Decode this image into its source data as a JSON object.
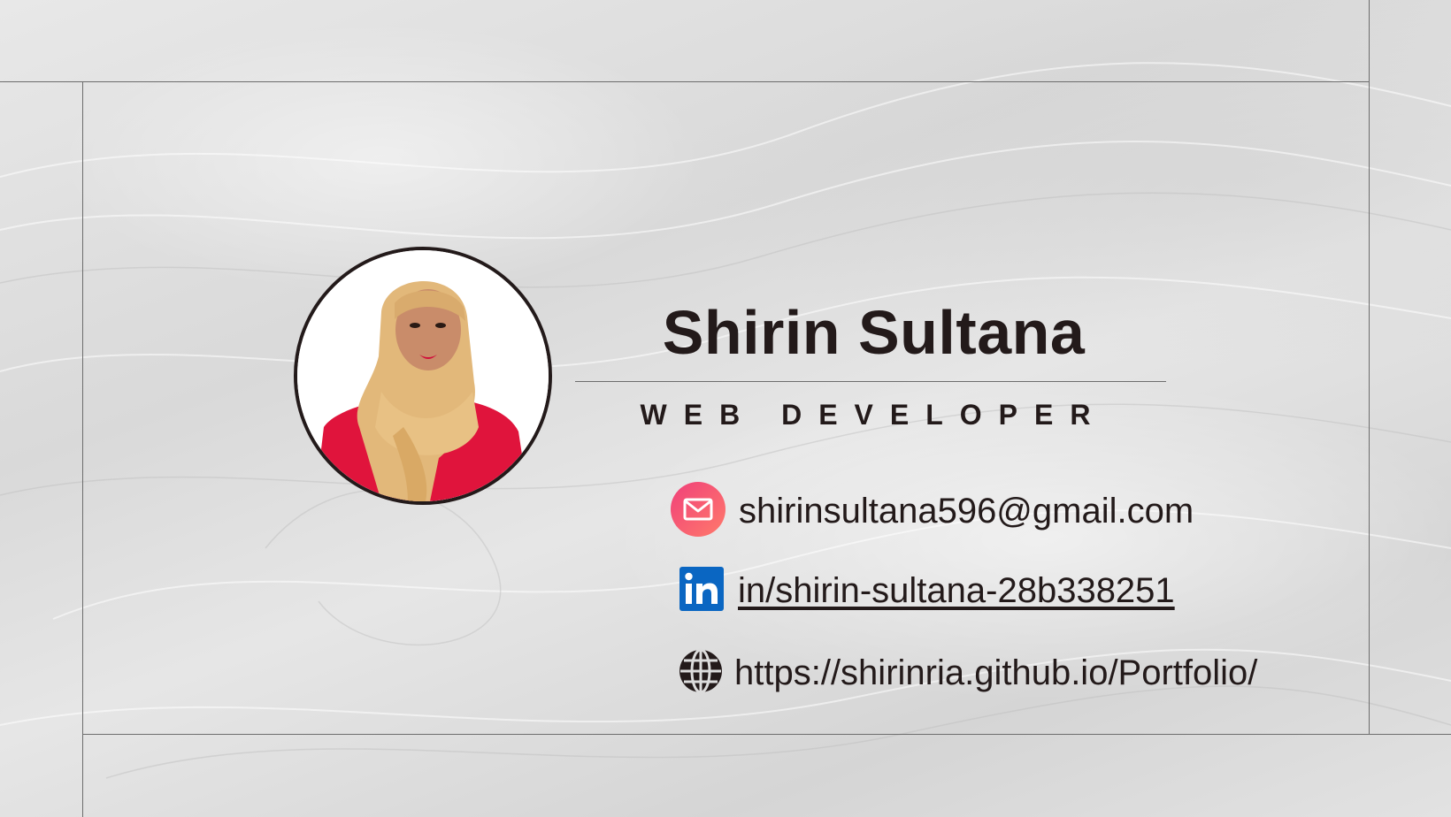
{
  "card": {
    "name": "Shirin Sultana",
    "role": "WEB DEVELOPER",
    "photo": {
      "description_icon": "profile-photo"
    }
  },
  "contacts": {
    "email": {
      "icon": "mail-icon",
      "text": "shirinsultana596@gmail.com"
    },
    "linkedin": {
      "icon": "linkedin-icon",
      "text": "in/shirin-sultana-28b338251"
    },
    "website": {
      "icon": "globe-icon",
      "text": "https://shirinria.github.io/Portfolio/"
    }
  },
  "colors": {
    "text": "#231a1a",
    "mail_icon_start": "#f0407a",
    "mail_icon_end": "#ff7a6b",
    "linkedin_blue": "#0a66c2",
    "frame_lines": "#6d6d6d"
  }
}
